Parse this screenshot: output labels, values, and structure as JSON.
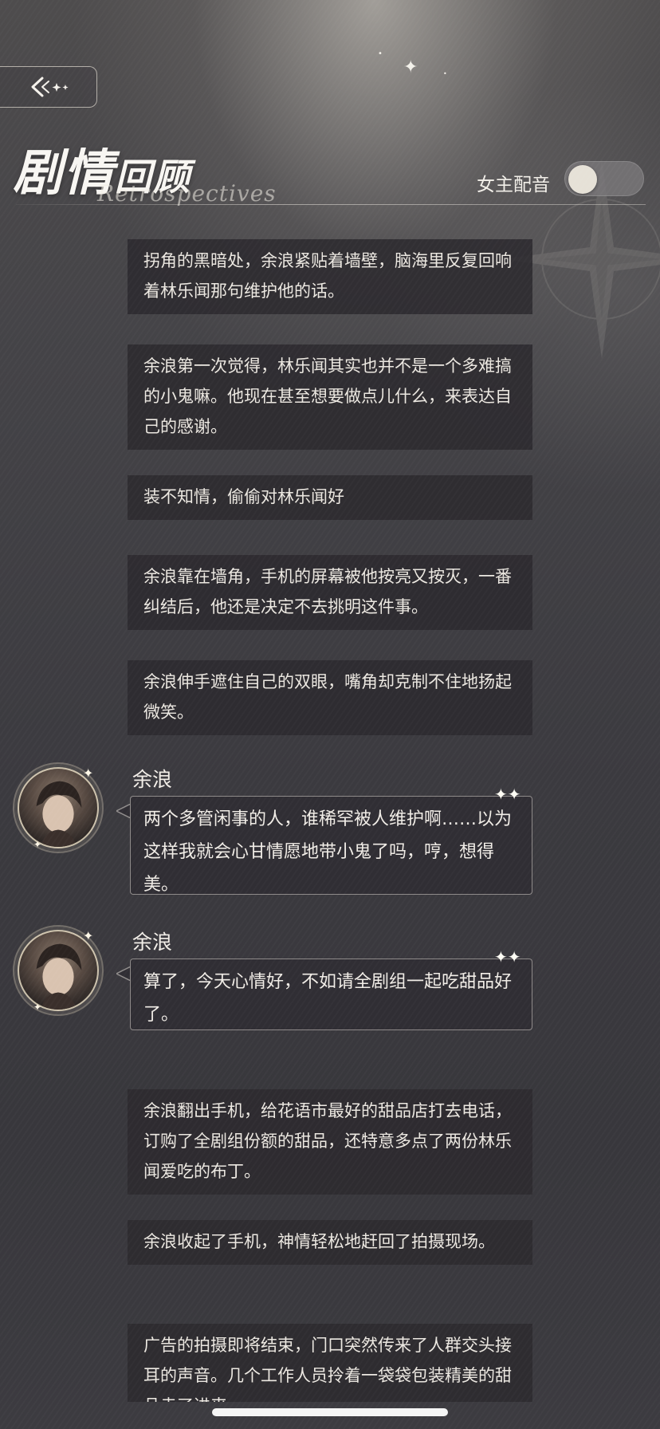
{
  "header": {
    "title_main": "剧情",
    "title_small": "回顾",
    "subtitle": "Retrospectives",
    "voice_label": "女主配音",
    "voice_enabled": false
  },
  "entries": [
    {
      "type": "narration",
      "text": "拐角的黑暗处，余浪紧贴着墙壁，脑海里反复回响着林乐闻那句维护他的话。"
    },
    {
      "type": "narration",
      "text": "余浪第一次觉得，林乐闻其实也并不是一个多难搞的小鬼嘛。他现在甚至想要做点儿什么，来表达自己的感谢。"
    },
    {
      "type": "narration",
      "text": "装不知情，偷偷对林乐闻好"
    },
    {
      "type": "narration",
      "text": "余浪靠在墙角，手机的屏幕被他按亮又按灭，一番纠结后，他还是决定不去挑明这件事。"
    },
    {
      "type": "narration",
      "text": "余浪伸手遮住自己的双眼，嘴角却克制不住地扬起微笑。"
    },
    {
      "type": "dialogue",
      "speaker": "余浪",
      "text": "两个多管闲事的人，谁稀罕被人维护啊……以为这样我就会心甘情愿地带小鬼了吗，哼，想得美。"
    },
    {
      "type": "dialogue",
      "speaker": "余浪",
      "text": "算了，今天心情好，不如请全剧组一起吃甜品好了。"
    },
    {
      "type": "narration",
      "text": "余浪翻出手机，给花语市最好的甜品店打去电话，订购了全剧组份额的甜品，还特意多点了两份林乐闻爱吃的布丁。"
    },
    {
      "type": "narration",
      "text": "余浪收起了手机，神情轻松地赶回了拍摄现场。"
    },
    {
      "type": "narration",
      "text": "广告的拍摄即将结束，门口突然传来了人群交头接耳的声音。几个工作人员拎着一袋袋包装精美的甜品走了进来。"
    }
  ],
  "icons": {
    "back": "back-arrow-sparkle-icon",
    "toggle": "toggle-switch"
  },
  "colors": {
    "narration_bg": "#2c2a2f",
    "text": "#ece8e1",
    "accent": "#e6e1d7"
  }
}
